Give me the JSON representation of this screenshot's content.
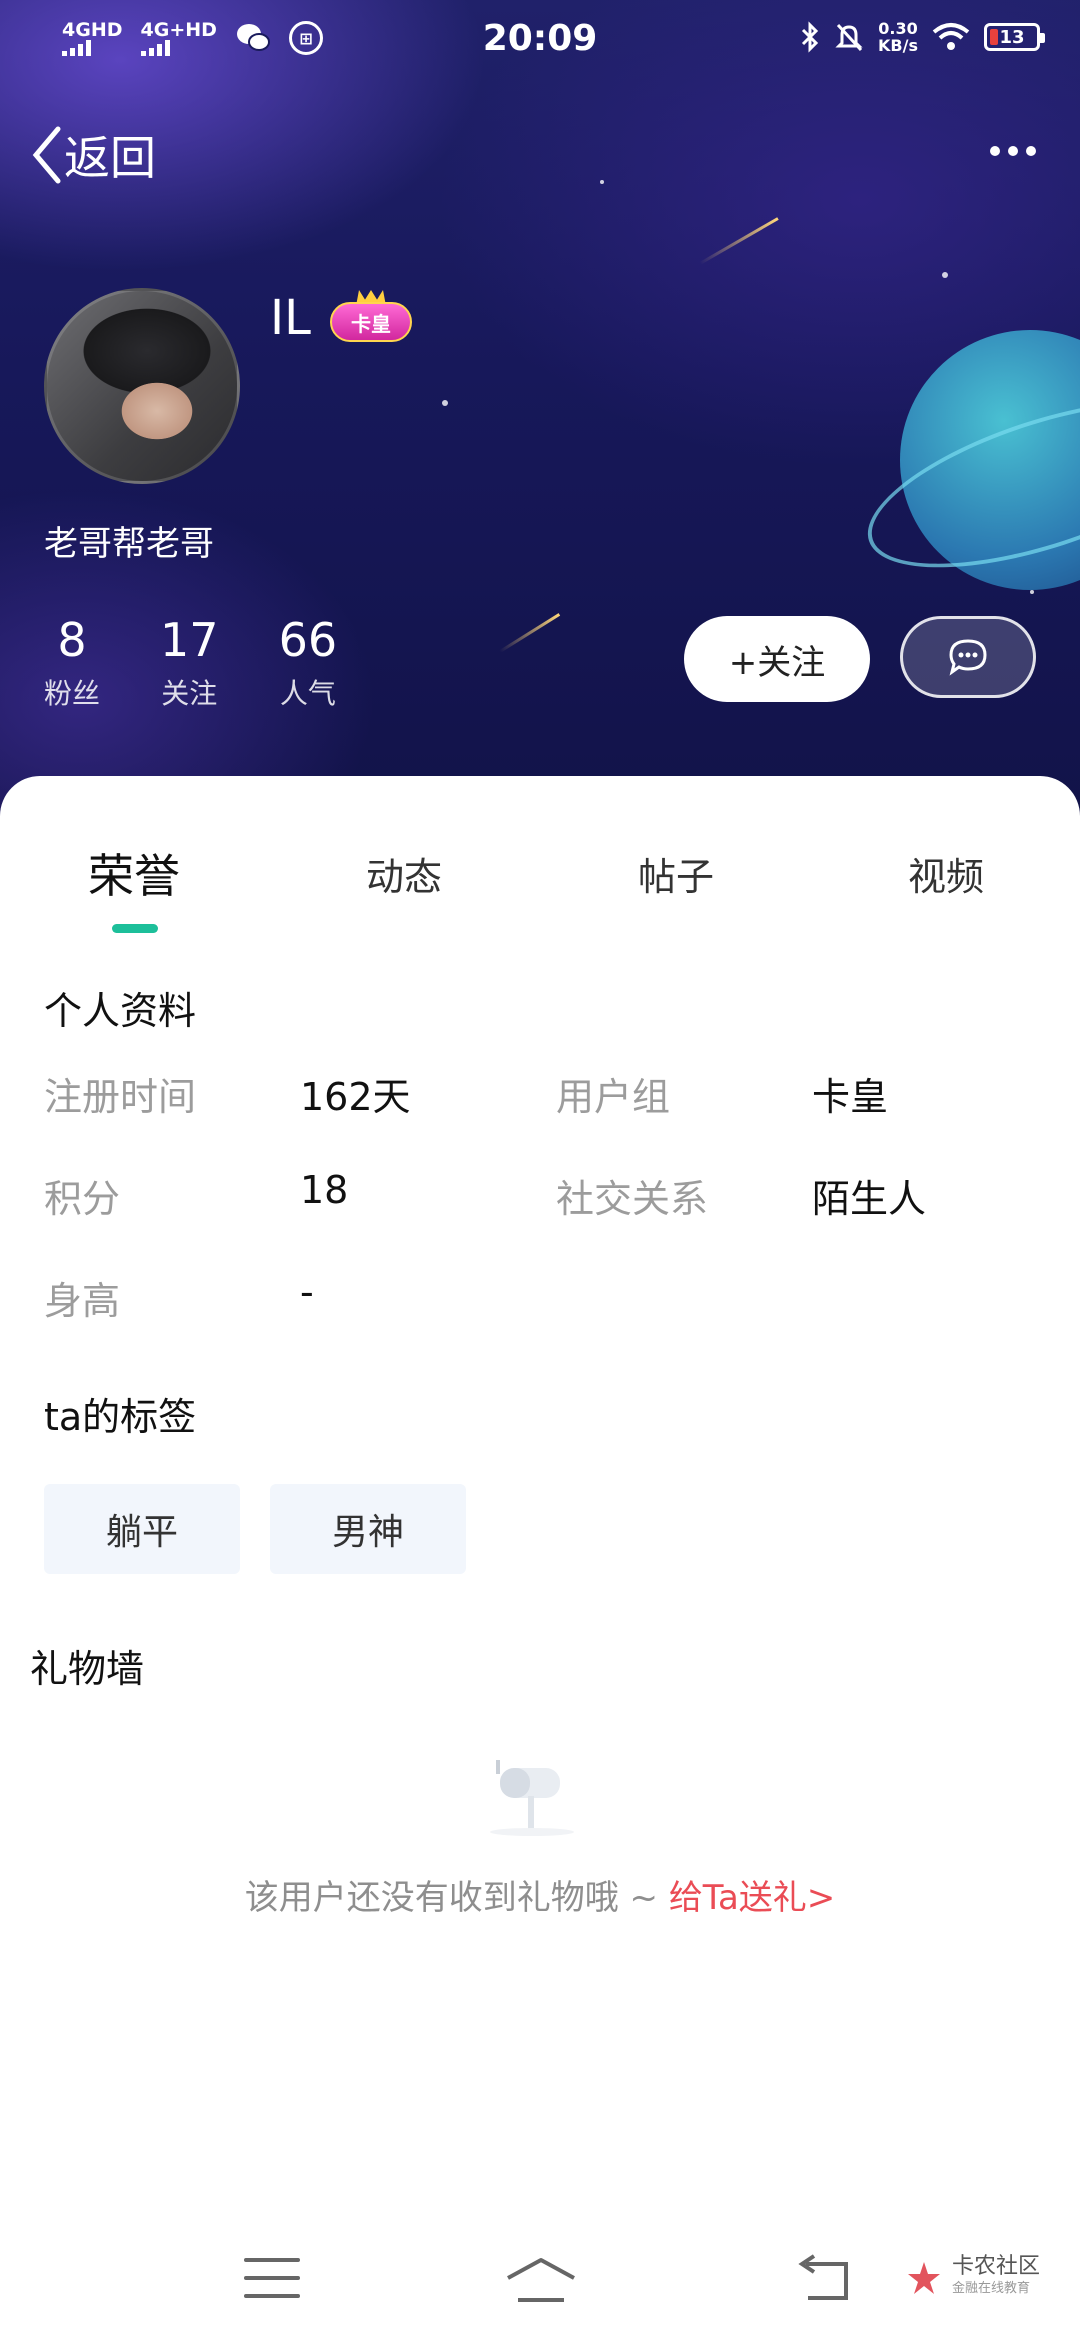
{
  "status_bar": {
    "sim1": "4GHD",
    "sim2": "4G+HD",
    "time": "20:09",
    "net_speed_value": "0.30",
    "net_speed_unit": "KB/s",
    "battery": "13",
    "icons": [
      "wechat-icon",
      "app-icon",
      "bluetooth-icon",
      "mute-icon",
      "wifi-icon",
      "battery-icon"
    ]
  },
  "nav": {
    "back_label": "返回",
    "more_icon": "more-icon"
  },
  "profile": {
    "username": "IL",
    "badge": "卡皇",
    "signature": "老哥帮老哥",
    "stats": [
      {
        "value": "8",
        "label": "粉丝"
      },
      {
        "value": "17",
        "label": "关注"
      },
      {
        "value": "66",
        "label": "人气"
      }
    ],
    "follow_label": "+关注",
    "message_icon": "chat-bubble-icon"
  },
  "tabs": [
    {
      "label": "荣誉",
      "active": true
    },
    {
      "label": "动态",
      "active": false
    },
    {
      "label": "帖子",
      "active": false
    },
    {
      "label": "视频",
      "active": false
    }
  ],
  "personal_info": {
    "title": "个人资料",
    "fields": [
      {
        "label": "注册时间",
        "value": "162天"
      },
      {
        "label": "用户组",
        "value": "卡皇"
      },
      {
        "label": "积分",
        "value": "18"
      },
      {
        "label": "社交关系",
        "value": "陌生人"
      },
      {
        "label": "身高",
        "value": "-"
      }
    ]
  },
  "tags_section": {
    "title": "ta的标签",
    "tags": [
      "躺平",
      "男神"
    ]
  },
  "gift_wall": {
    "title": "礼物墙",
    "empty_text": "该用户还没有收到礼物哦 ~ ",
    "send_link": "给Ta送礼>"
  },
  "watermark": {
    "text": "卡农社区",
    "subtext": "金融在线教育"
  },
  "colors": {
    "accent": "#1dbf9a",
    "link": "#ea4c55",
    "header_bg": "#1a1b5c"
  }
}
